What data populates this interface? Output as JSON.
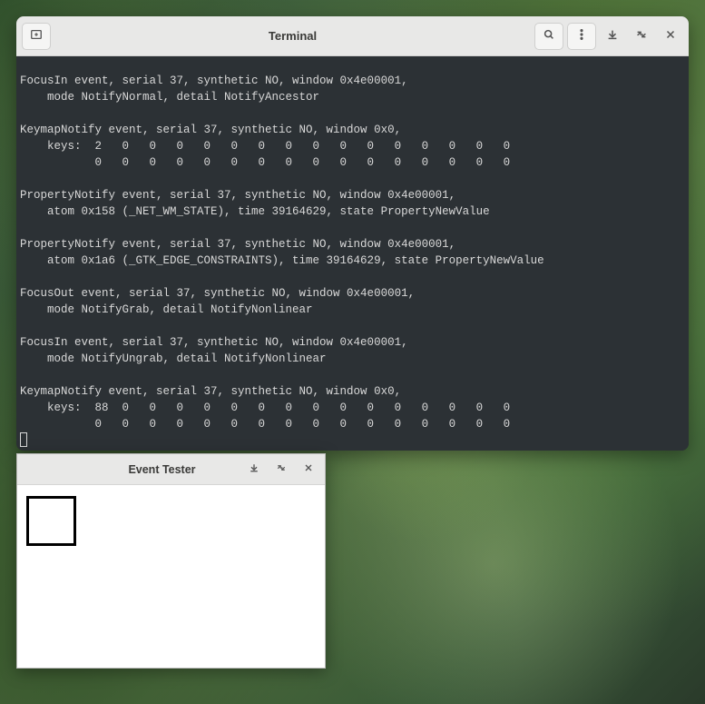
{
  "terminal": {
    "title": "Terminal",
    "output": "\nFocusIn event, serial 37, synthetic NO, window 0x4e00001,\n    mode NotifyNormal, detail NotifyAncestor\n\nKeymapNotify event, serial 37, synthetic NO, window 0x0,\n    keys:  2   0   0   0   0   0   0   0   0   0   0   0   0   0   0   0\n           0   0   0   0   0   0   0   0   0   0   0   0   0   0   0   0\n\nPropertyNotify event, serial 37, synthetic NO, window 0x4e00001,\n    atom 0x158 (_NET_WM_STATE), time 39164629, state PropertyNewValue\n\nPropertyNotify event, serial 37, synthetic NO, window 0x4e00001,\n    atom 0x1a6 (_GTK_EDGE_CONSTRAINTS), time 39164629, state PropertyNewValue\n\nFocusOut event, serial 37, synthetic NO, window 0x4e00001,\n    mode NotifyGrab, detail NotifyNonlinear\n\nFocusIn event, serial 37, synthetic NO, window 0x4e00001,\n    mode NotifyUngrab, detail NotifyNonlinear\n\nKeymapNotify event, serial 37, synthetic NO, window 0x0,\n    keys:  88  0   0   0   0   0   0   0   0   0   0   0   0   0   0   0\n           0   0   0   0   0   0   0   0   0   0   0   0   0   0   0   0"
  },
  "event_tester": {
    "title": "Event Tester"
  },
  "icons": {
    "new_tab": "new-tab",
    "search": "search",
    "menu": "menu",
    "minimize": "minimize",
    "maximize": "maximize",
    "close": "close"
  }
}
